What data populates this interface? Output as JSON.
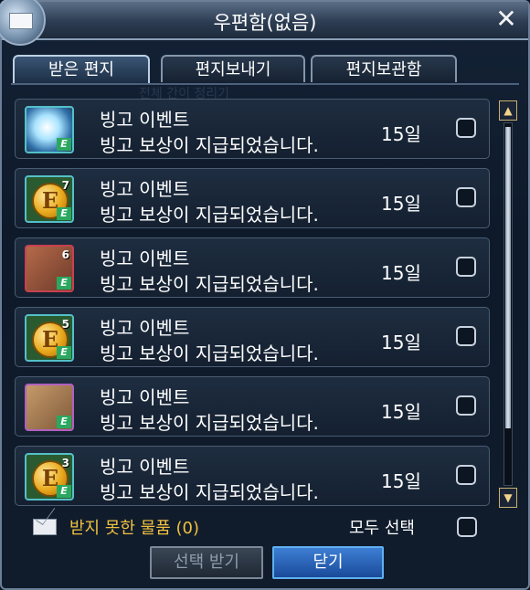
{
  "window": {
    "title": "우편함(없음)",
    "close_glyph": "✕"
  },
  "tabs": [
    {
      "label": "받은 편지",
      "active": true
    },
    {
      "label": "편지보내기",
      "active": false
    },
    {
      "label": "편지보관함",
      "active": false
    }
  ],
  "background_text": "전체 간이 정리기",
  "mails": [
    {
      "icon": "burst-icon",
      "count": "",
      "title": "빙고 이벤트",
      "body": "빙고 보상이 지급되었습니다.",
      "days": "15일"
    },
    {
      "icon": "gold-coin-icon",
      "count": "7",
      "title": "빙고 이벤트",
      "body": "빙고 보상이 지급되었습니다.",
      "days": "15일"
    },
    {
      "icon": "ticket-bag-icon",
      "count": "6",
      "title": "빙고 이벤트",
      "body": "빙고 보상이 지급되었습니다.",
      "days": "15일"
    },
    {
      "icon": "gold-coin-icon",
      "count": "5",
      "title": "빙고 이벤트",
      "body": "빙고 보상이 지급되었습니다.",
      "days": "15일"
    },
    {
      "icon": "gift-box-icon",
      "count": "",
      "title": "빙고 이벤트",
      "body": "빙고 보상이 지급되었습니다.",
      "days": "15일"
    },
    {
      "icon": "gold-coin-icon",
      "count": "3",
      "title": "빙고 이벤트",
      "body": "빙고 보상이 지급되었습니다.",
      "days": "15일"
    }
  ],
  "coin_letter": "E",
  "badge_letter": "E",
  "footer": {
    "undelivered_label": "받지 못한 물품 (0)",
    "select_all_label": "모두 선택",
    "receive_button": "선택 받기",
    "close_button": "닫기"
  },
  "colors": {
    "undelivered": "#f0c040",
    "close_button": "#2f6fc8"
  }
}
